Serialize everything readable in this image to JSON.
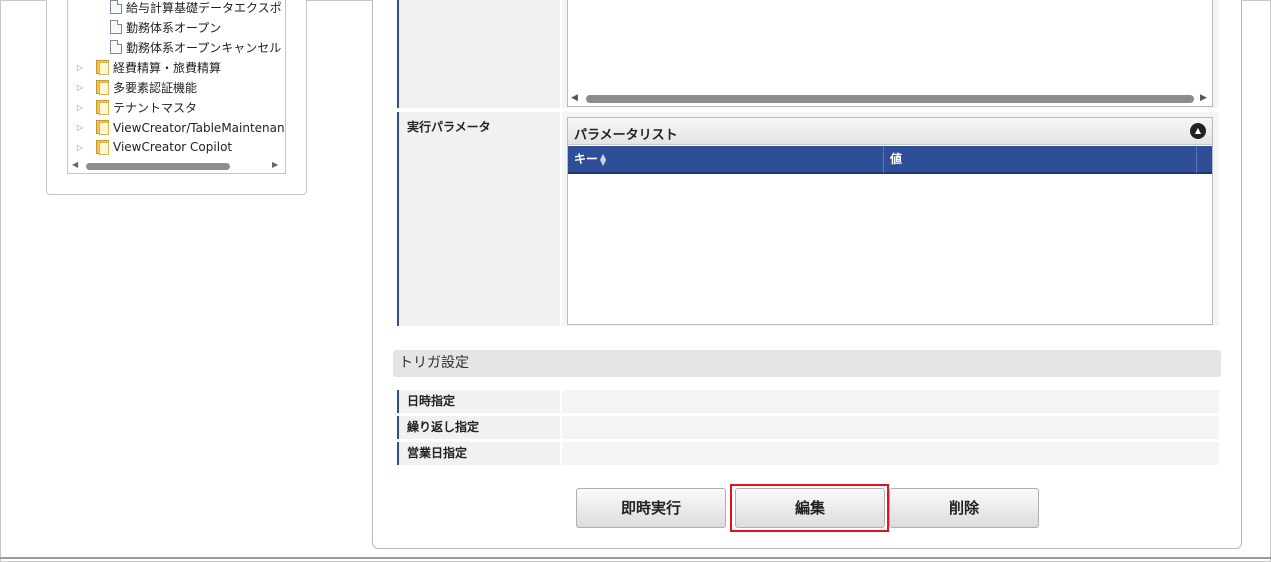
{
  "tree": {
    "items": [
      {
        "label": "給与計算基礎データエクスポ",
        "type": "doc"
      },
      {
        "label": "勤務体系オープン",
        "type": "doc"
      },
      {
        "label": "勤務体系オープンキャンセル",
        "type": "doc"
      },
      {
        "label": "経費精算・旅費精算",
        "type": "folder"
      },
      {
        "label": "多要素認証機能",
        "type": "folder"
      },
      {
        "label": "テナントマスタ",
        "type": "folder"
      },
      {
        "label": "ViewCreator/TableMaintenance ま",
        "type": "folder"
      },
      {
        "label": "ViewCreator Copilot",
        "type": "folder"
      }
    ],
    "toggle_glyph": "▷",
    "scroll_left": "◀",
    "scroll_right": "▶"
  },
  "form": {
    "exec_param_label": "実行パラメータ",
    "param_list": {
      "title": "パラメータリスト",
      "collapse_glyph": "▲",
      "columns": [
        "キー",
        "値"
      ],
      "sort_glyph": "▲▼",
      "rows": []
    },
    "scroll_left": "◀",
    "scroll_right": "▶"
  },
  "trigger": {
    "section_title": "トリガ設定",
    "rows": [
      {
        "label": "日時指定",
        "value": ""
      },
      {
        "label": "繰り返し指定",
        "value": ""
      },
      {
        "label": "営業日指定",
        "value": ""
      }
    ]
  },
  "buttons": {
    "run_now": "即時実行",
    "edit": "編集",
    "delete": "削除"
  },
  "colors": {
    "accent": "#2e4f98",
    "highlight": "#e0121c"
  }
}
